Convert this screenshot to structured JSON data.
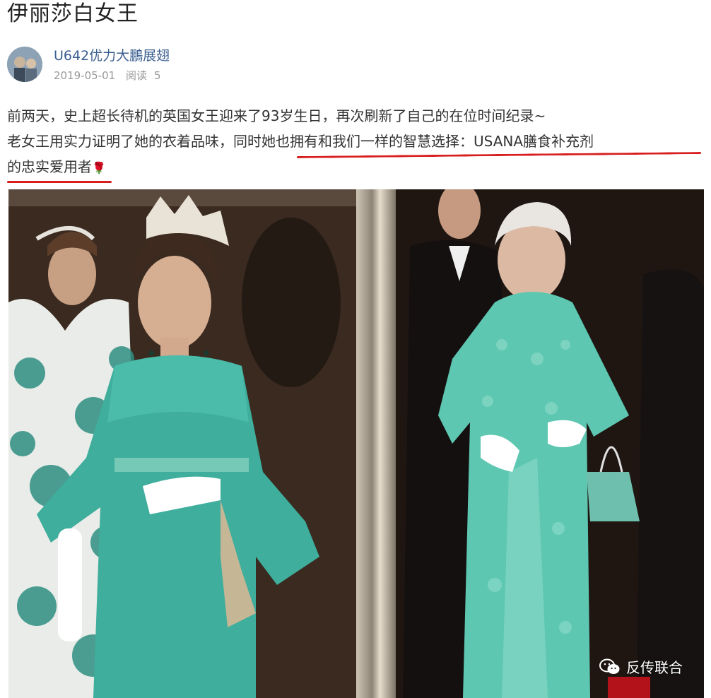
{
  "article": {
    "title": "伊丽莎白女王",
    "author": "U642优力大鵬展翅",
    "date": "2019-05-01",
    "read_label": "阅读",
    "read_count": "5",
    "paragraph_lines": [
      "前两天，史上超长待机的英国女王迎来了93岁生日，再次刷新了自己的在位时间纪录~",
      "老女王用实力证明了她的衣着品味，同时她也拥有和我们一样的智慧选择：USANA膳食补充剂",
      "的忠实爱用者"
    ],
    "emoji": "🌹"
  },
  "colors": {
    "underline": "#d81e1e",
    "link": "#3a5f8f",
    "gown_green": "#3fae9c"
  },
  "watermark": {
    "icon": "wechat-icon",
    "text": "反传联合"
  }
}
